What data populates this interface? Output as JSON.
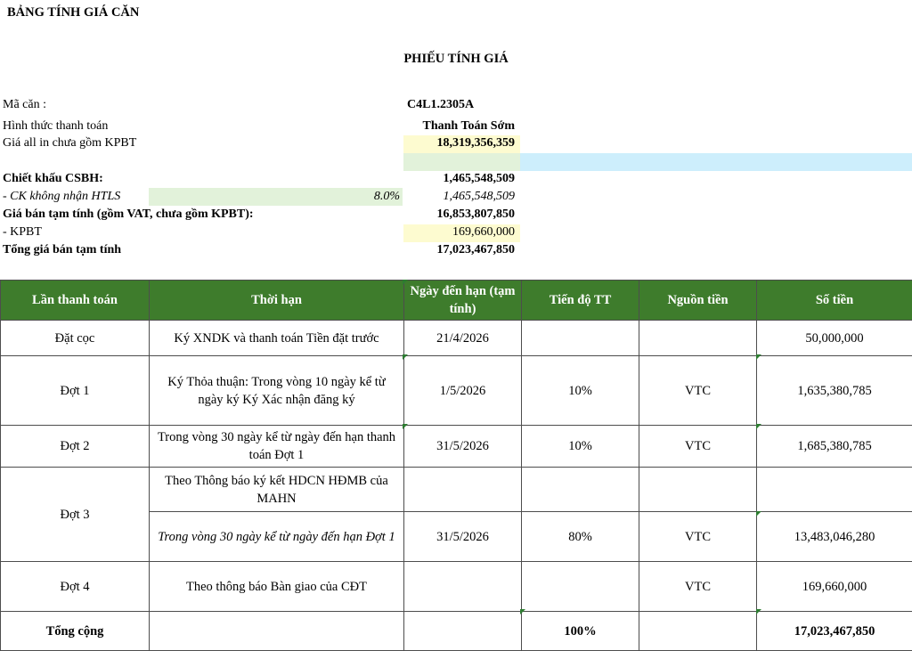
{
  "header": {
    "sheet_title": "BẢNG TÍNH GIÁ CĂN",
    "form_title": "PHIẾU TÍNH GIÁ"
  },
  "summary": {
    "unit_code_label": "Mã căn :",
    "unit_code_value": "C4L1.2305A",
    "payment_method_label": "Hình thức thanh toán",
    "payment_method_value": "Thanh Toán Sớm",
    "all_in_label": "Giá all in chưa gồm KPBT",
    "all_in_value": "18,319,356,359",
    "discount_label": "Chiết khấu CSBH:",
    "discount_value": "1,465,548,509",
    "ck_label": "- CK không nhận HTLS",
    "ck_percent": "8.0%",
    "ck_value": "1,465,548,509",
    "temp_price_label": "Giá bán tạm tính (gồm VAT, chưa gồm KPBT):",
    "temp_price_value": "16,853,807,850",
    "kpbt_label": "- KPBT",
    "kpbt_value": "169,660,000",
    "total_label": "Tổng giá bán tạm tính",
    "total_value": "17,023,467,850"
  },
  "table": {
    "headers": {
      "installment": "Lần thanh toán",
      "term": "Thời hạn",
      "due_date": "Ngày đến hạn (tạm tính)",
      "progress": "Tiến độ TT",
      "source": "Nguồn tiền",
      "amount": "Số tiền"
    },
    "rows": [
      {
        "installment": "Đặt cọc",
        "term": "Ký XNDK và thanh toán Tiền đặt trước",
        "due_date": "21/4/2026",
        "progress": "",
        "source": "",
        "amount": "50,000,000"
      },
      {
        "installment": "Đợt 1",
        "term": "Ký Thỏa thuận: Trong vòng 10 ngày kể từ ngày ký Ký Xác nhận đăng ký",
        "due_date": "1/5/2026",
        "progress": "10%",
        "source": "VTC",
        "amount": "1,635,380,785"
      },
      {
        "installment": "Đợt 2",
        "term": "Trong vòng 30 ngày kể từ ngày đến hạn thanh toán Đợt 1",
        "due_date": "31/5/2026",
        "progress": "10%",
        "source": "VTC",
        "amount": "1,685,380,785"
      },
      {
        "installment": "Đợt 3",
        "term": "Theo Thông báo ký kết HDCN HĐMB của MAHN",
        "term_2": "Trong vòng 30 ngày kể từ ngày đến hạn Đợt 1",
        "due_date": "31/5/2026",
        "progress": "80%",
        "source": "VTC",
        "amount": "13,483,046,280"
      },
      {
        "installment": "Đợt 4",
        "term": "Theo thông báo Bàn giao của CĐT",
        "due_date": "",
        "progress": "",
        "source": "VTC",
        "amount": "169,660,000"
      }
    ],
    "total": {
      "label": "Tổng cộng",
      "progress": "100%",
      "amount": "17,023,467,850"
    }
  },
  "colors": {
    "header_green": "#3e7c2c",
    "highlight_yellow": "#fdfbd0",
    "highlight_green": "#e2f2da",
    "highlight_blue": "#cdeefc"
  }
}
